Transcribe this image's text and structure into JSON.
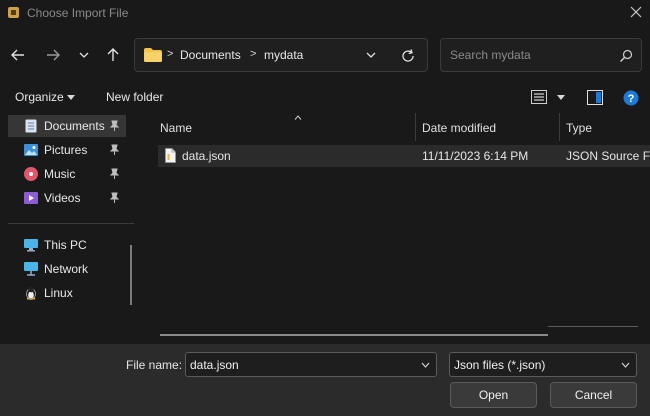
{
  "window": {
    "title": "Choose Import File",
    "close_icon": "close-icon",
    "app_icon": "app-icon"
  },
  "nav": {
    "back_icon": "arrow-left-icon",
    "forward_icon": "arrow-right-icon",
    "recent_icon": "chevron-down-icon",
    "up_icon": "arrow-up-icon"
  },
  "address": {
    "crumbs": [
      "Documents",
      "mydata"
    ],
    "refresh_icon": "refresh-icon"
  },
  "search": {
    "placeholder": "Search mydata"
  },
  "toolbar": {
    "organize": "Organize",
    "new_folder": "New folder"
  },
  "sidebar": {
    "items": [
      {
        "label": "Documents",
        "icon": "documents-icon",
        "pinned": true,
        "selected": true
      },
      {
        "label": "Pictures",
        "icon": "pictures-icon",
        "pinned": true
      },
      {
        "label": "Music",
        "icon": "music-icon",
        "pinned": true
      },
      {
        "label": "Videos",
        "icon": "videos-icon",
        "pinned": true
      },
      {
        "label": "This PC",
        "icon": "computer-icon"
      },
      {
        "label": "Network",
        "icon": "network-icon"
      },
      {
        "label": "Linux",
        "icon": "linux-icon"
      }
    ]
  },
  "table": {
    "columns": [
      "Name",
      "Date modified",
      "Type"
    ],
    "rows": [
      {
        "name": "data.json",
        "date": "11/11/2023 6:14 PM",
        "type": "JSON Source File"
      }
    ]
  },
  "footer": {
    "file_name_label": "File name:",
    "file_name_value": "data.json",
    "file_type_value": "Json files (*.json)",
    "open_label": "Open",
    "cancel_label": "Cancel"
  },
  "colors": {
    "background": "#191919",
    "footer": "#2b2b2b",
    "selected": "#363636",
    "accent_help": "#1e7ad8",
    "folder": "#f2c14e"
  }
}
